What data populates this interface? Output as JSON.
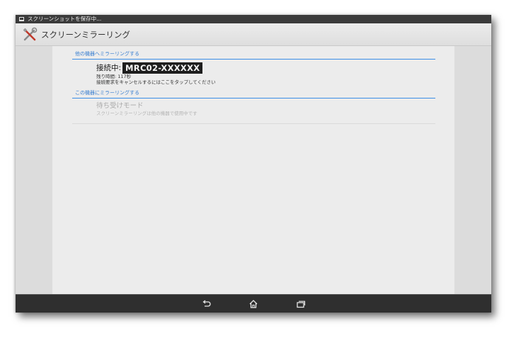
{
  "status_bar": {
    "notification_icon": "screenshot-icon",
    "text": "スクリーンショットを保存中..."
  },
  "action_bar": {
    "icon": "tools-icon",
    "title": "スクリーンミラーリング"
  },
  "sections": {
    "to_other_device": {
      "header": "他の機器へミラーリングする",
      "connection": {
        "label": "接続中:",
        "device_name": "MRC02-XXXXXX",
        "remaining_time": "残り時間: 117秒",
        "cancel_hint": "接続要求をキャンセルするにはここをタップしてください"
      }
    },
    "to_this_device": {
      "header": "この機器にミラーリングする",
      "standby": {
        "title": "待ち受けモード",
        "subtitle": "スクリーンミラーリングは他の機器で使用中です"
      }
    }
  },
  "nav_bar": {
    "buttons": [
      "back-icon",
      "home-icon",
      "recent-apps-icon"
    ]
  },
  "colors": {
    "accent": "#3a8ee6",
    "status_bar": "#3b3b3b",
    "nav_bar": "#2f2f2f",
    "content_bg": "#ececec",
    "side_bg": "#dcdcdc"
  }
}
